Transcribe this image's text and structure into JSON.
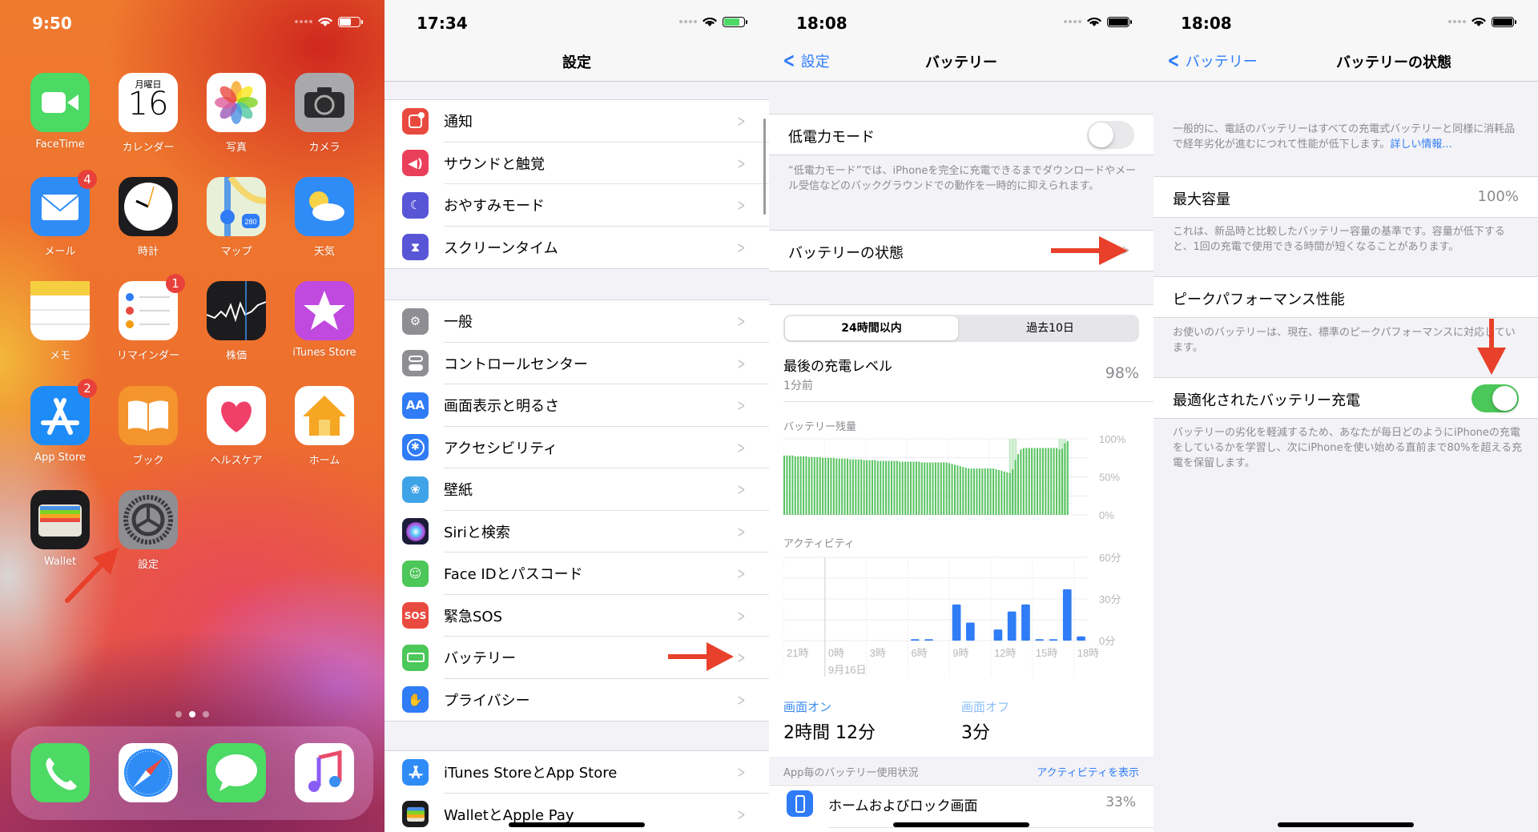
{
  "home": {
    "time": "9:50",
    "apps": [
      {
        "label": "FaceTime",
        "icon": "facetime-icon",
        "color": "#4cd964"
      },
      {
        "label": "カレンダー",
        "icon": "calendar-icon",
        "color": "#ffffff",
        "weekday": "月曜日",
        "day": "16"
      },
      {
        "label": "写真",
        "icon": "photos-icon",
        "color": "#ffffff"
      },
      {
        "label": "カメラ",
        "icon": "camera-icon",
        "color": "#a8a8ad"
      },
      {
        "label": "メール",
        "icon": "mail-icon",
        "color": "#2f8cf6",
        "badge": "4"
      },
      {
        "label": "時計",
        "icon": "clock-icon",
        "color": "#1c1c1e"
      },
      {
        "label": "マップ",
        "icon": "maps-icon",
        "color": "#e8f0d8"
      },
      {
        "label": "天気",
        "icon": "weather-icon",
        "color": "#2f8cf6"
      },
      {
        "label": "メモ",
        "icon": "notes-icon",
        "color": "#ffffff"
      },
      {
        "label": "リマインダー",
        "icon": "reminders-icon",
        "color": "#ffffff",
        "badge": "1"
      },
      {
        "label": "株価",
        "icon": "stocks-icon",
        "color": "#1c1c1e"
      },
      {
        "label": "iTunes Store",
        "icon": "itunes-store-icon",
        "color": "#c04ae0"
      },
      {
        "label": "App Store",
        "icon": "app-store-icon",
        "color": "#1e8cf6",
        "badge": "2"
      },
      {
        "label": "ブック",
        "icon": "books-icon",
        "color": "#f4942c"
      },
      {
        "label": "ヘルスケア",
        "icon": "health-icon",
        "color": "#ffffff"
      },
      {
        "label": "ホーム",
        "icon": "home-app-icon",
        "color": "#ffffff"
      },
      {
        "label": "Wallet",
        "icon": "wallet-icon",
        "color": "#1c1c1e"
      },
      {
        "label": "設定",
        "icon": "settings-icon",
        "color": "#8e8e93"
      }
    ],
    "dock": [
      {
        "icon": "phone-icon",
        "color": "#4cd964"
      },
      {
        "icon": "safari-icon",
        "color": "#ffffff"
      },
      {
        "icon": "messages-icon",
        "color": "#4cd964"
      },
      {
        "icon": "music-icon",
        "color": "#ffffff"
      }
    ],
    "page_count": 3,
    "current_page": 2
  },
  "settings": {
    "time": "17:34",
    "title": "設定",
    "groups": [
      [
        {
          "label": "通知",
          "icon": "notifications-icon",
          "color": "#e94a3f"
        },
        {
          "label": "サウンドと触覚",
          "icon": "sounds-icon",
          "color": "#ea3f5a"
        },
        {
          "label": "おやすみモード",
          "icon": "moon-icon",
          "color": "#5856d6"
        },
        {
          "label": "スクリーンタイム",
          "icon": "hourglass-icon",
          "color": "#5856d6"
        }
      ],
      [
        {
          "label": "一般",
          "icon": "gear-icon",
          "color": "#8e8e93"
        },
        {
          "label": "コントロールセンター",
          "icon": "toggles-icon",
          "color": "#8e8e93"
        },
        {
          "label": "画面表示と明るさ",
          "icon": "display-icon",
          "color": "#2f7cf6",
          "glyph": "AA"
        },
        {
          "label": "アクセシビリティ",
          "icon": "accessibility-icon",
          "color": "#2f7cf6"
        },
        {
          "label": "壁紙",
          "icon": "wallpaper-icon",
          "color": "#3fa3e8"
        },
        {
          "label": "Siriと検索",
          "icon": "siri-icon",
          "color": "#1c1c3a"
        },
        {
          "label": "Face IDとパスコード",
          "icon": "faceid-icon",
          "color": "#4cc759"
        },
        {
          "label": "緊急SOS",
          "icon": "sos-icon",
          "color": "#e94a3f",
          "glyph": "SOS"
        },
        {
          "label": "バッテリー",
          "icon": "battery-icon",
          "color": "#4cc759"
        },
        {
          "label": "プライバシー",
          "icon": "hand-icon",
          "color": "#2f7cf6"
        }
      ],
      [
        {
          "label": "iTunes StoreとApp Store",
          "icon": "app-store-icon",
          "color": "#2f8cf6"
        },
        {
          "label": "WalletとApple Pay",
          "icon": "wallet-icon",
          "color": "#1c1c1e"
        }
      ]
    ]
  },
  "battery": {
    "time": "18:08",
    "back_label": "設定",
    "title": "バッテリー",
    "low_power_label": "低電力モード",
    "low_power_on": false,
    "low_power_footer": "“低電力モード”では、iPhoneを完全に充電できるまでダウンロードやメール受信などのバックグラウンドでの動作を一時的に抑えられます。",
    "health_label": "バッテリーの状態",
    "segments": [
      "24時間以内",
      "過去10日"
    ],
    "selected_segment": "24時間以内",
    "last_charge_label": "最後の充電レベル",
    "last_charge_time": "1分前",
    "last_charge_value": "98%",
    "screen_on_label": "画面オン",
    "screen_on_value": "2時間 12分",
    "screen_off_label": "画面オフ",
    "screen_off_value": "3分",
    "app_usage_label": "App毎のバッテリー使用状況",
    "show_activity_label": "アクティビティを表示",
    "apps": [
      {
        "label": "ホームおよびロック画面",
        "value": "33%",
        "icon": "home-lock-screen-icon"
      }
    ]
  },
  "battery_health": {
    "time": "18:08",
    "back_label": "バッテリー",
    "title": "バッテリーの状態",
    "intro": "一般的に、電話のバッテリーはすべての充電式バッテリーと同様に消耗品で経年劣化が進むにつれて性能が低下します。",
    "learn_more": "詳しい情報...",
    "max_capacity_label": "最大容量",
    "max_capacity_value": "100%",
    "max_capacity_footer": "これは、新品時と比較したバッテリー容量の基準です。容量が低下すると、1回の充電で使用できる時間が短くなることがあります。",
    "peak_label": "ピークパフォーマンス性能",
    "peak_footer": "お使いのバッテリーは、現在、標準のピークパフォーマンスに対応しています。",
    "optimized_label": "最適化されたバッテリー充電",
    "optimized_on": true,
    "optimized_footer": "バッテリーの劣化を軽減するため、あなたが毎日どのようにiPhoneの充電をしているかを学習し、次にiPhoneを使い始める直前まで80%を超える充電を保留します。"
  },
  "chart_data": [
    {
      "type": "bar",
      "title": "バッテリー残量",
      "ylim": [
        0,
        100
      ],
      "yticks": [
        "100%",
        "50%",
        "0%"
      ],
      "unit": "%",
      "x_note": "15-minute intervals over last 24h",
      "values": [
        78,
        78,
        78,
        78,
        77,
        77,
        77,
        77,
        77,
        76,
        76,
        76,
        76,
        76,
        75,
        75,
        75,
        75,
        75,
        74,
        74,
        74,
        74,
        74,
        73,
        73,
        73,
        73,
        73,
        72,
        72,
        72,
        72,
        72,
        71,
        71,
        71,
        71,
        71,
        71,
        71,
        71,
        70,
        70,
        70,
        70,
        70,
        70,
        70,
        70,
        69,
        69,
        69,
        69,
        69,
        69,
        69,
        69,
        69,
        69,
        68,
        67,
        66,
        65,
        64,
        63,
        62,
        61,
        61,
        61,
        61,
        61,
        61,
        61,
        61,
        61,
        61,
        60,
        59,
        58,
        57,
        56,
        55,
        60,
        72,
        80,
        86,
        88,
        88,
        88,
        88,
        88,
        88,
        88,
        88,
        88,
        88,
        88,
        88,
        88,
        86,
        87,
        94,
        97
      ],
      "charging_ranges": [
        [
          82,
          84
        ],
        [
          100,
          102
        ]
      ],
      "color": "#5ac463"
    },
    {
      "type": "bar",
      "title": "アクティビティ",
      "ylim": [
        0,
        60
      ],
      "yticks": [
        "60分",
        "30分",
        "0分"
      ],
      "categories": [
        "21時",
        "22時",
        "23時",
        "0時",
        "1時",
        "2時",
        "3時",
        "4時",
        "5時",
        "6時",
        "7時",
        "8時",
        "9時",
        "10時",
        "11時",
        "12時",
        "13時",
        "14時",
        "15時",
        "16時",
        "17時",
        "18時"
      ],
      "xticks": [
        "21時",
        "0時",
        "3時",
        "6時",
        "9時",
        "12時",
        "15時",
        "18時"
      ],
      "date_label": "9月16日",
      "values": [
        0,
        0,
        0,
        0,
        0,
        0,
        0,
        0,
        0,
        1,
        1,
        0,
        26,
        13,
        0,
        8,
        21,
        26,
        1,
        1,
        37,
        3
      ],
      "color": "#2f7cf6"
    }
  ]
}
